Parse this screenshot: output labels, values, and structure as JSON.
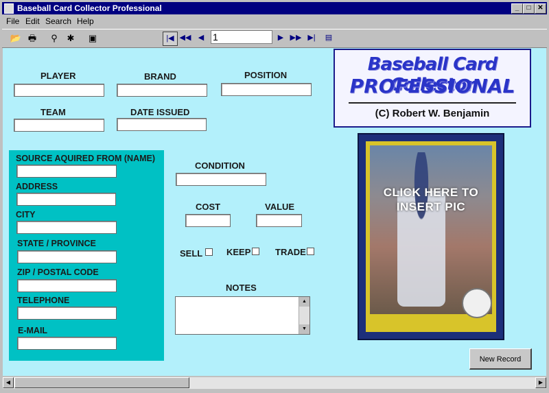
{
  "window": {
    "title": "Baseball Card Collector Professional"
  },
  "menubar": {
    "items": [
      "File",
      "Edit",
      "Search",
      "Help"
    ]
  },
  "toolbar": {
    "record_number": "1"
  },
  "form": {
    "labels": {
      "player": "PLAYER",
      "brand": "BRAND",
      "position": "POSITION",
      "team": "TEAM",
      "date_issued": "DATE ISSUED",
      "source": "SOURCE AQUIRED FROM (NAME)",
      "address": "ADDRESS",
      "city": "CITY",
      "state": "STATE / PROVINCE",
      "zip": "ZIP / POSTAL CODE",
      "telephone": "TELEPHONE",
      "email": "E-MAIL",
      "condition": "CONDITION",
      "cost": "COST",
      "value": "VALUE",
      "sell": "SELL",
      "keep": "KEEP",
      "trade": "TRADE",
      "notes": "NOTES"
    }
  },
  "logo": {
    "line1": "Baseball Card Collector",
    "line2": "PROFESSIONAL",
    "copyright": "(C) Robert W. Benjamin"
  },
  "card_picture": {
    "prompt": "CLICK HERE TO INSERT PIC"
  },
  "buttons": {
    "new_record": "New Record"
  },
  "colors": {
    "form_background": "#b3f0fb",
    "source_panel": "#00c1c4",
    "titlebar": "#000080"
  }
}
